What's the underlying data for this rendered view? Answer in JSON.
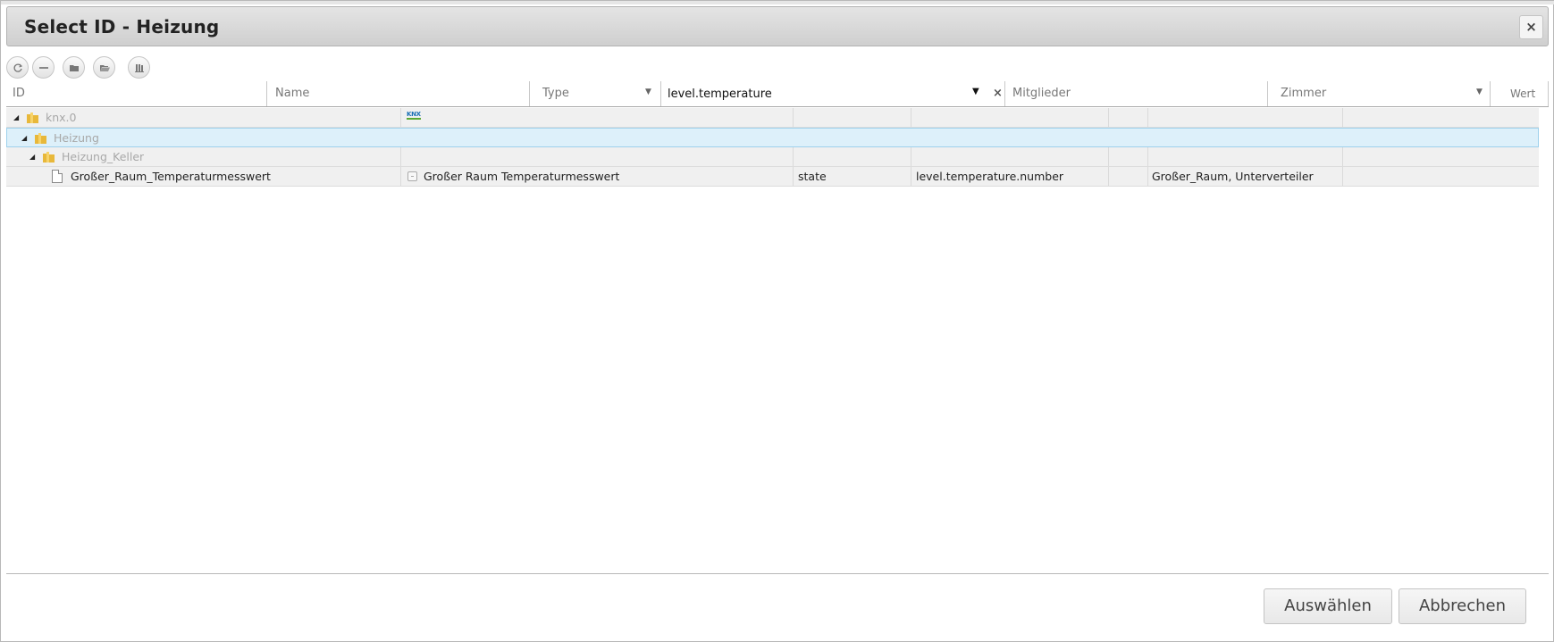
{
  "dialog": {
    "title": "Select ID - Heizung",
    "close_label": "×"
  },
  "toolbar": {
    "buttons": [
      "refresh-icon",
      "collapse-icon",
      "folder-icon",
      "folder-open-icon",
      "list-icon"
    ]
  },
  "columns": {
    "id": "ID",
    "name": "Name",
    "type": "Type",
    "role_filter_value": "level.temperature",
    "clear_label": "×",
    "members": "Mitglieder",
    "rooms": "Zimmer",
    "value": "Wert"
  },
  "tree": {
    "rows": [
      {
        "label": "knx.0",
        "name": "",
        "type": "",
        "role": "",
        "rooms": ""
      },
      {
        "label": "Heizung",
        "name": "",
        "type": "",
        "role": "",
        "rooms": ""
      },
      {
        "label": "Heizung_Keller",
        "name": "",
        "type": "",
        "role": "",
        "rooms": ""
      },
      {
        "label": "Großer_Raum_Temperaturmesswert",
        "name": "Großer Raum Temperaturmesswert",
        "type": "state",
        "role": "level.temperature.number",
        "rooms": "Großer_Raum, Unterverteiler"
      }
    ],
    "adapter_icon_text": "KNX"
  },
  "footer": {
    "select_label": "Auswählen",
    "cancel_label": "Abbrechen"
  },
  "colors": {
    "selected_row": "#ddf0fa",
    "folder": "#e8b83a",
    "title_bar": "#d8d8d8"
  }
}
